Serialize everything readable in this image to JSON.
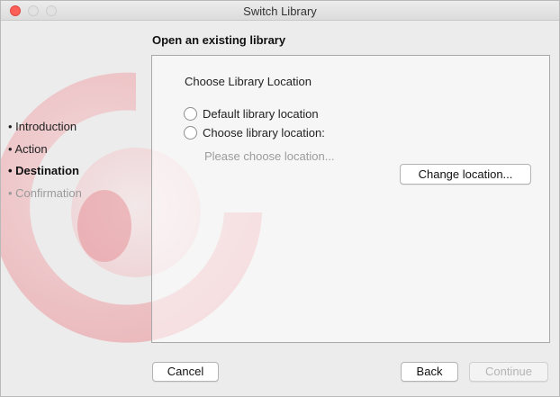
{
  "window": {
    "title": "Switch Library"
  },
  "page": {
    "heading": "Open an existing library"
  },
  "steps": [
    {
      "label": "Introduction",
      "state": "done"
    },
    {
      "label": "Action",
      "state": "done"
    },
    {
      "label": "Destination",
      "state": "current"
    },
    {
      "label": "Confirmation",
      "state": "pending"
    }
  ],
  "panel": {
    "title": "Choose Library Location",
    "options": [
      {
        "label": "Default library location",
        "selected": false
      },
      {
        "label": "Choose library location:",
        "selected": false
      }
    ],
    "location_placeholder": "Please choose location...",
    "change_button": "Change location..."
  },
  "footer": {
    "cancel": "Cancel",
    "back": "Back",
    "continue": "Continue"
  },
  "colors": {
    "close_button": "#fc5f57",
    "watermark": "#e8898f"
  },
  "icons": {
    "watermark": "app-logo-icon"
  }
}
